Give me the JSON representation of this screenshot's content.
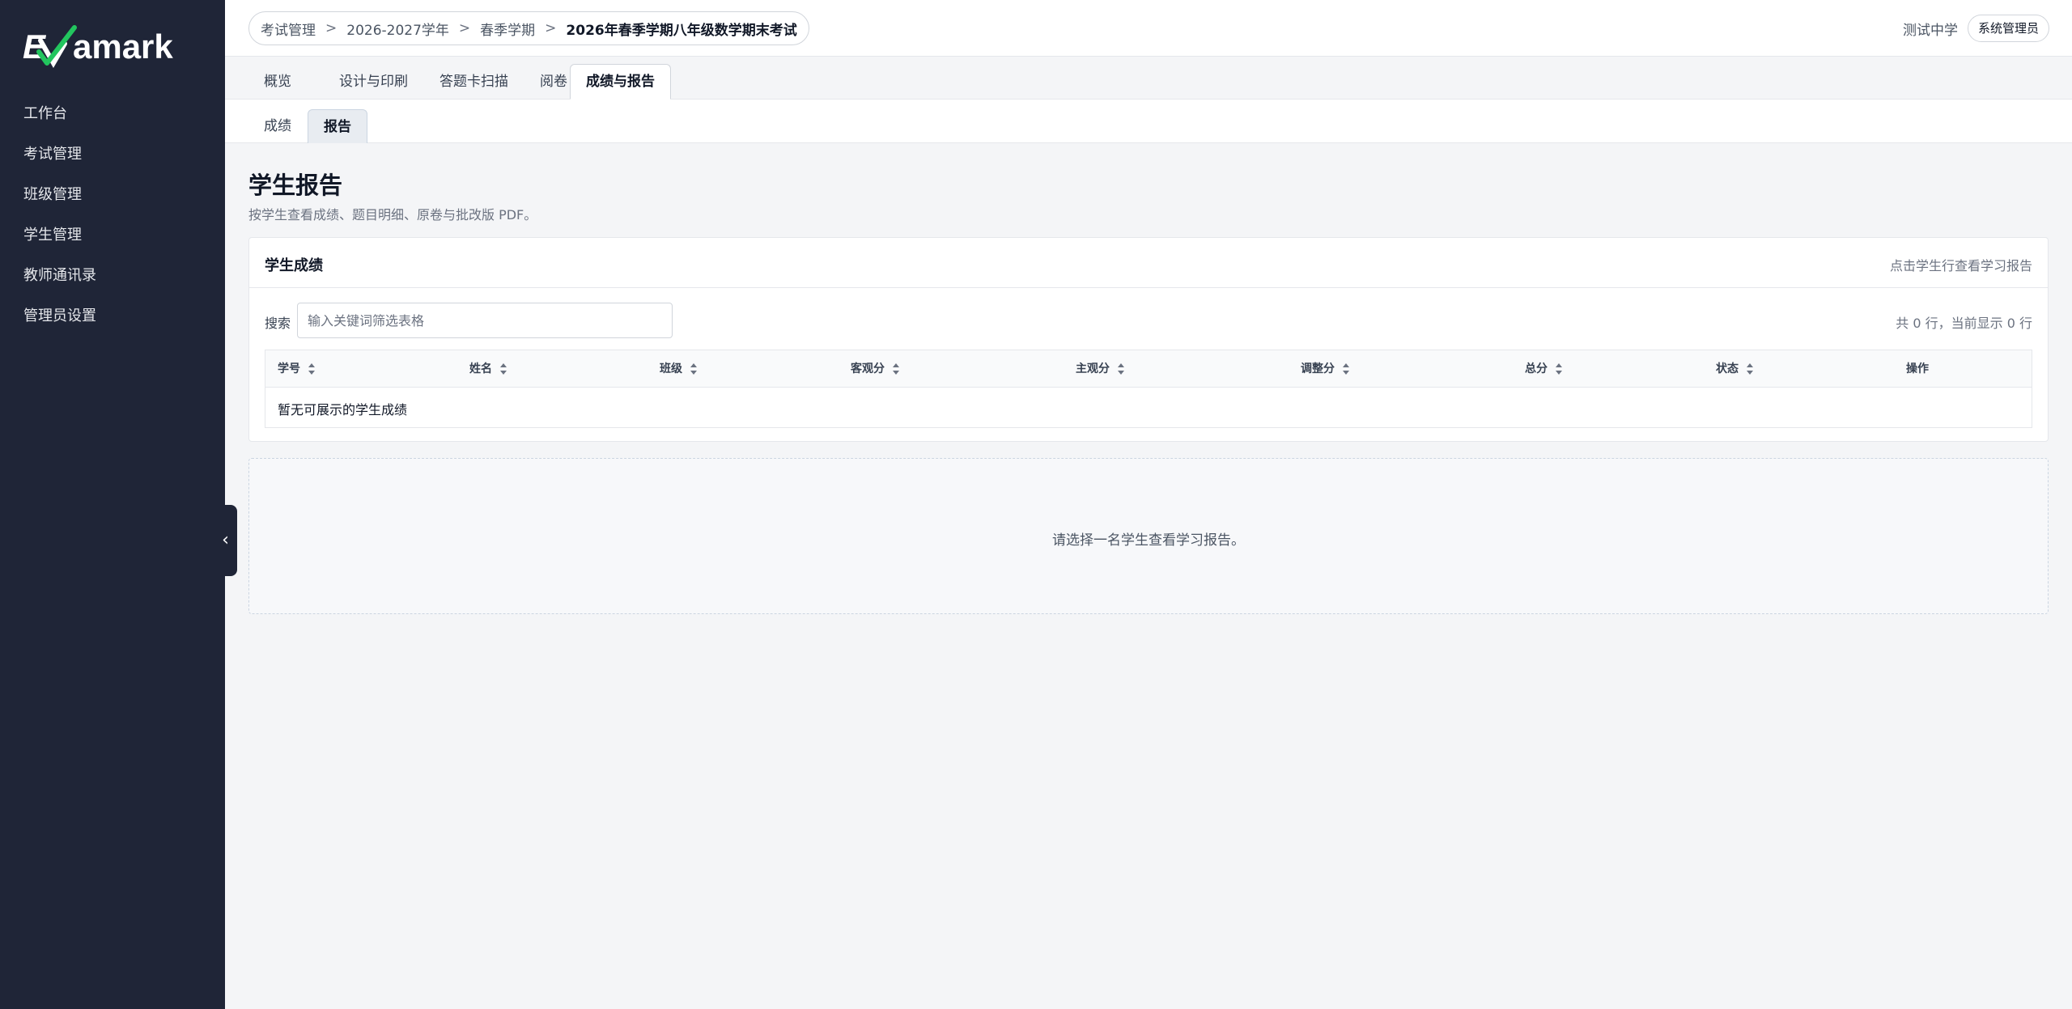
{
  "app": {
    "logo_text": "Examark",
    "accent_color": "#22c55e"
  },
  "sidebar": {
    "items": [
      {
        "label": "工作台"
      },
      {
        "label": "考试管理"
      },
      {
        "label": "班级管理"
      },
      {
        "label": "学生管理"
      },
      {
        "label": "教师通讯录"
      },
      {
        "label": "管理员设置"
      }
    ],
    "collapse_glyph": "‹"
  },
  "breadcrumb": {
    "items": [
      "考试管理",
      "2026-2027学年",
      "春季学期"
    ],
    "current": "2026年春季学期八年级数学期末考试",
    "separator": ">"
  },
  "header": {
    "school": "测试中学",
    "role": "系统管理员"
  },
  "tabs": [
    {
      "label": "概览"
    },
    {
      "label": "设计与印刷"
    },
    {
      "label": "答题卡扫描"
    },
    {
      "label": "阅卷"
    },
    {
      "label": "成绩与报告",
      "active": true
    }
  ],
  "subtabs": [
    {
      "label": "成绩"
    },
    {
      "label": "报告",
      "active": true
    }
  ],
  "page": {
    "title": "学生报告",
    "subtitle": "按学生查看成绩、题目明细、原卷与批改版 PDF。"
  },
  "scores_card": {
    "title": "学生成绩",
    "hint": "点击学生行查看学习报告",
    "search_label": "搜索",
    "search_placeholder": "输入关键词筛选表格",
    "search_value": "",
    "row_count": "共 0 行，当前显示 0 行",
    "columns": [
      {
        "label": "学号",
        "sortable": true
      },
      {
        "label": "姓名",
        "sortable": true
      },
      {
        "label": "班级",
        "sortable": true
      },
      {
        "label": "客观分",
        "sortable": true
      },
      {
        "label": "主观分",
        "sortable": true
      },
      {
        "label": "调整分",
        "sortable": true
      },
      {
        "label": "总分",
        "sortable": true
      },
      {
        "label": "状态",
        "sortable": true
      },
      {
        "label": "操作",
        "sortable": false
      }
    ],
    "empty_text": "暂无可展示的学生成绩"
  },
  "report_panel": {
    "empty_text": "请选择一名学生查看学习报告。"
  }
}
